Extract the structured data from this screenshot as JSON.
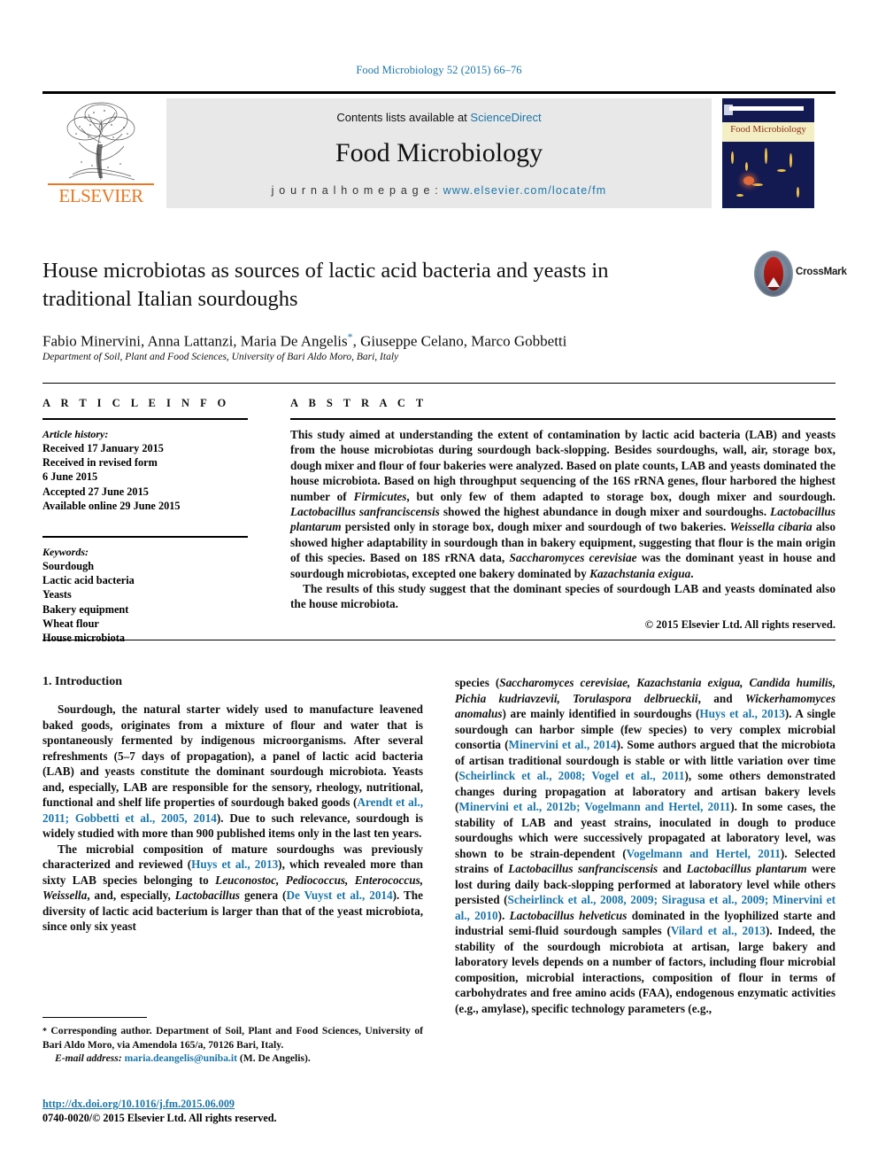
{
  "running_head": "Food Microbiology 52 (2015) 66–76",
  "masthead": {
    "publisher": "ELSEVIER",
    "contents_prefix": "Contents lists available at ",
    "contents_link": "ScienceDirect",
    "journal_name": "Food Microbiology",
    "homepage_label": "j o u r n a l   h o m e p a g e :  ",
    "homepage_url": "www.elsevier.com/locate/fm",
    "cover_band_text": "Food Microbiology"
  },
  "article": {
    "title": "House microbiotas as sources of lactic acid bacteria and yeasts in traditional Italian sourdoughs",
    "authors": "Fabio Minervini, Anna Lattanzi, Maria De Angelis",
    "authors_tail": ", Giuseppe Celano, Marco Gobbetti",
    "corresponding_marker": "*",
    "affiliation": "Department of Soil, Plant and Food Sciences, University of Bari Aldo Moro, Bari, Italy",
    "crossmark_label": "CrossMark"
  },
  "article_info": {
    "label": "A R T I C L E   I N F O",
    "history_head": "Article history:",
    "history": [
      "Received 17 January 2015",
      "Received in revised form",
      "6 June 2015",
      "Accepted 27 June 2015",
      "Available online 29 June 2015"
    ],
    "keywords_head": "Keywords:",
    "keywords": [
      "Sourdough",
      "Lactic acid bacteria",
      "Yeasts",
      "Bakery equipment",
      "Wheat flour",
      "House microbiota"
    ]
  },
  "abstract": {
    "label": "A B S T R A C T",
    "paragraph_1_a": "This study aimed at understanding the extent of contamination by lactic acid bacteria (LAB) and yeasts from the house microbiotas during sourdough back-slopping. Besides sourdoughs, wall, air, storage box, dough mixer and flour of four bakeries were analyzed. Based on plate counts, LAB and yeasts dominated the house microbiota. Based on high throughput sequencing of the 16S rRNA genes, flour harbored the highest number of ",
    "firmicutes": "Firmicutes",
    "paragraph_1_b": ", but only few of them adapted to storage box, dough mixer and sourdough. ",
    "lb_sanfranciscensis": "Lactobacillus sanfranciscensis",
    "paragraph_1_c": " showed the highest abundance in dough mixer and sourdoughs. ",
    "lb_plantarum": "Lactobacillus plantarum",
    "paragraph_1_d": " persisted only in storage box, dough mixer and sourdough of two bakeries. ",
    "w_cibaria": "Weissella cibaria",
    "paragraph_1_e": " also showed higher adaptability in sourdough than in bakery equipment, suggesting that flour is the main origin of this species. Based on 18S rRNA data, ",
    "s_cerevisiae": "Saccharomyces cerevisiae",
    "paragraph_1_f": " was the dominant yeast in house and sourdough microbiotas, excepted one bakery dominated by ",
    "k_exigua": "Kazachstania exigua",
    "paragraph_1_g": ".",
    "paragraph_2": "The results of this study suggest that the dominant species of sourdough LAB and yeasts dominated also the house microbiota.",
    "copyright": "© 2015 Elsevier Ltd. All rights reserved."
  },
  "introduction": {
    "heading": "1. Introduction",
    "left": {
      "p1_a": "Sourdough, the natural starter widely used to manufacture leavened baked goods, originates from a mixture of flour and water that is spontaneously fermented by indigenous microorganisms. After several refreshments (5–7 days of propagation), a panel of lactic acid bacteria (LAB) and yeasts constitute the dominant sourdough microbiota. Yeasts and, especially, LAB are responsible for the sensory, rheology, nutritional, functional and shelf life properties of sourdough baked goods (",
      "p1_cite1": "Arendt et al., 2011; Gobbetti et al., 2005, 2014",
      "p1_b": "). Due to such relevance, sourdough is widely studied with more than 900 published items only in the last ten years.",
      "p2_a": "The microbial composition of mature sourdoughs was previously characterized and reviewed (",
      "p2_cite1": "Huys et al., 2013",
      "p2_b": "), which revealed more than sixty LAB species belonging to ",
      "p2_it1": "Leuconostoc, Pediococcus, Enterococcus, Weissella",
      "p2_c": ", and, especially, ",
      "p2_it2": "Lactobacillus",
      "p2_d": " genera (",
      "p2_cite2": "De Vuyst et al., 2014",
      "p2_e": "). The diversity of lactic acid bacterium is larger than that of the yeast microbiota, since only six yeast"
    },
    "right": {
      "p_a": "species (",
      "it1": "Saccharomyces cerevisiae, Kazachstania exigua, Candida humilis, Pichia kudriavzevii, Torulaspora delbrueckii",
      "p_b": ", and ",
      "it2": "Wickerhamomyces anomalus",
      "p_c": ") are mainly identified in sourdoughs (",
      "cite1": "Huys et al., 2013",
      "p_d": "). A single sourdough can harbor simple (few species) to very complex microbial consortia (",
      "cite2": "Minervini et al., 2014",
      "p_e": "). Some authors argued that the microbiota of artisan traditional sourdough is stable or with little variation over time (",
      "cite3": "Scheirlinck et al., 2008; Vogel et al., 2011",
      "p_f": "), some others demonstrated changes during propagation at laboratory and artisan bakery levels (",
      "cite4": "Minervini et al., 2012b; Vogelmann and Hertel, 2011",
      "p_g": "). In some cases, the stability of LAB and yeast strains, inoculated in dough to produce sourdoughs which were successively propagated at laboratory level, was shown to be strain-dependent (",
      "cite5": "Vogelmann and Hertel, 2011",
      "p_h": "). Selected strains of ",
      "it3": "Lactobacillus sanfranciscensis",
      "p_i": " and ",
      "it4": "Lactobacillus plantarum",
      "p_j": " were lost during daily back-slopping performed at laboratory level while others persisted (",
      "cite6": "Scheirlinck et al., 2008, 2009; Siragusa et al., 2009; Minervini et al., 2010",
      "p_k": "). ",
      "it5": "Lactobacillus helveticus",
      "p_l": " dominated in the lyophilized starte and industrial semi-fluid sourdough samples (",
      "cite7": "Vilard et al., 2013",
      "p_m": "). Indeed, the stability of the sourdough microbiota at artisan, large bakery and laboratory levels depends on a number of factors, including flour microbial composition, microbial interactions, composition of flour in terms of carbohydrates and free amino acids (FAA), endogenous enzymatic activities (e.g., amylase), specific technology parameters (e.g.,"
    }
  },
  "footnotes": {
    "corresponding_star": "*",
    "corresponding": " Corresponding author. Department of Soil, Plant and Food Sciences, University of Bari Aldo Moro, via Amendola 165/a, 70126 Bari, Italy.",
    "email_label": "E-mail address:",
    "email": "maria.deangelis@uniba.it",
    "email_owner": "(M. De Angelis).",
    "doi": "http://dx.doi.org/10.1016/j.fm.2015.06.009",
    "issn_line": "0740-0020/© 2015 Elsevier Ltd. All rights reserved."
  },
  "colors": {
    "link": "#1b76a8",
    "elsevier_orange": "#e87722",
    "panel_gray": "#e8e8e8",
    "cover_blue": "#131a52"
  }
}
